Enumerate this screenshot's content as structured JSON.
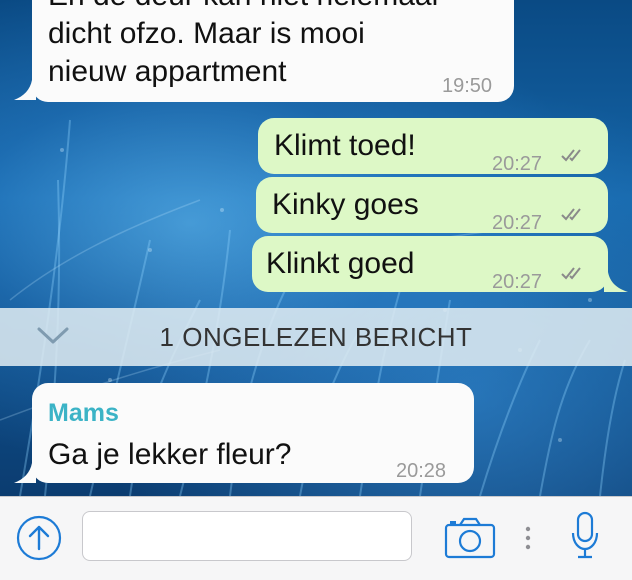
{
  "messages": [
    {
      "id": "m1",
      "direction": "incoming",
      "lines": [
        "En de deur kan niet helemaal",
        "dicht ofzo. Maar is mooi",
        "nieuw appartment"
      ],
      "time": "19:50"
    },
    {
      "id": "m2",
      "direction": "outgoing",
      "text": "Klimt toed!",
      "time": "20:27",
      "status": "read-double-check"
    },
    {
      "id": "m3",
      "direction": "outgoing",
      "text": "Kinky goes",
      "time": "20:27",
      "status": "read-double-check"
    },
    {
      "id": "m4",
      "direction": "outgoing",
      "text": "Klinkt goed",
      "time": "20:27",
      "status": "read-double-check"
    }
  ],
  "unread_divider": {
    "text": "1 ONGELEZEN BERICHT",
    "icon": "chevron-down-icon"
  },
  "incoming_named": {
    "sender": "Mams",
    "text": "Ga je lekker fleur?",
    "time": "20:28"
  },
  "input_bar": {
    "placeholder": "",
    "icons": [
      "share-arrow-up-icon",
      "camera-icon",
      "more-dots-icon",
      "microphone-icon"
    ]
  },
  "colors": {
    "outgoing_bubble": "#ddf8c6",
    "incoming_bubble": "#fbfbfb",
    "sender_name": "#3bb3c6",
    "timestamp": "#9a9a9a",
    "accent_icon": "#1d7bd6",
    "unread_bar": "#e1ecf2"
  }
}
